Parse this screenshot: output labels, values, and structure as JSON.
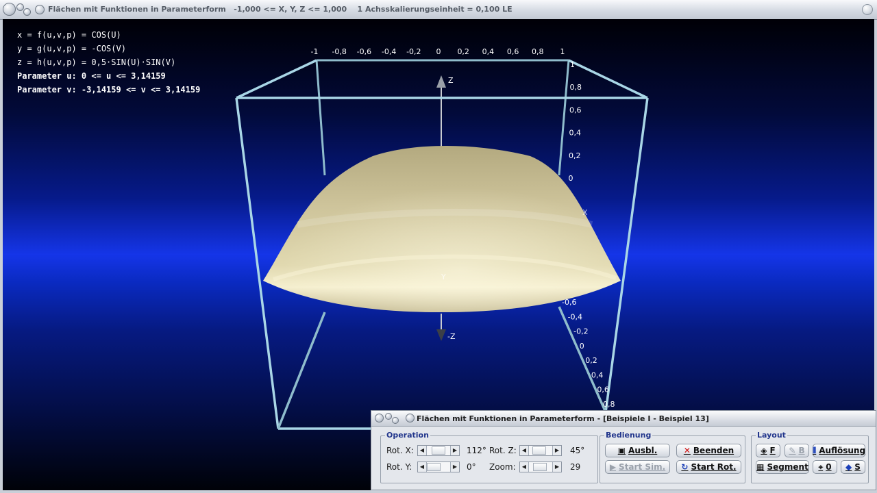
{
  "window": {
    "title": "Flächen mit Funktionen in Parameterform   -1,000 <= X, Y, Z <= 1,000    1 Achsskalierungseinheit = 0,100 LE"
  },
  "equations": {
    "x": "x = f(u,v,p) = COS(U)",
    "y": "y = g(u,v,p) = -COS(V)",
    "z": "z = h(u,v,p) = 0,5·SIN(U)·SIN(V)",
    "param_u": "Parameter u: 0 <= u <= 3,14159",
    "param_v": "Parameter v: -3,14159 <= v <= 3,14159"
  },
  "scene": {
    "top_ticks": [
      "-1",
      "-0,8",
      "-0,6",
      "-0,4",
      "-0,2",
      "0",
      "0,2",
      "0,4",
      "0,6",
      "0,8",
      "1"
    ],
    "right_ticks": [
      "1",
      "0,8",
      "0,6",
      "0,4",
      "0,2",
      "0"
    ],
    "depth_ticks": [
      "-0,6",
      "-0,4",
      "-0,2",
      "0",
      "0,2",
      "0,4",
      "0,6",
      "0,8"
    ],
    "axis_z": "Z",
    "axis_minus_z": "-Z",
    "axis_x": "X",
    "axis_y": "Y",
    "colors": {
      "frame": "#a9d6e6",
      "surface": "#cdc39a"
    }
  },
  "panel": {
    "title": "Flächen mit Funktionen in Parameterform - [Beispiele I - Beispiel 13]",
    "operation": {
      "label": "Operation",
      "rot_x_label": "Rot. X:",
      "rot_x_value": "112°",
      "rot_y_label": "Rot. Y:",
      "rot_y_value": "0°",
      "rot_z_label": "Rot. Z:",
      "rot_z_value": "45°",
      "zoom_label": "Zoom:",
      "zoom_value": "29"
    },
    "bedienung": {
      "label": "Bedienung",
      "ausbl": "Ausbl.",
      "beenden": "Beenden",
      "start_sim": "Start Sim.",
      "start_rot": "Start Rot."
    },
    "layout": {
      "label": "Layout",
      "f": "F",
      "b": "B",
      "aufloesung": "Auflösung",
      "segment": "Segment",
      "zero": "0",
      "s": "S"
    }
  }
}
